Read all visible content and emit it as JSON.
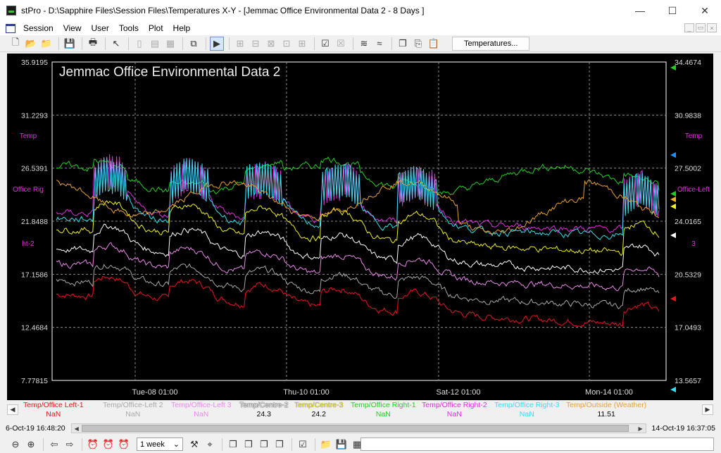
{
  "window": {
    "title": "stPro - D:\\Sapphire Files\\Session Files\\Temperatures X-Y - [Jemmac Office Environmental Data 2 - 8 Days ]",
    "minimize_glyph": "—",
    "maximize_glyph": "☐",
    "close_glyph": "✕"
  },
  "menu": {
    "items": [
      {
        "name": "menu-session",
        "label": "Session"
      },
      {
        "name": "menu-view",
        "label": "View"
      },
      {
        "name": "menu-user",
        "label": "User"
      },
      {
        "name": "menu-tools",
        "label": "Tools"
      },
      {
        "name": "menu-plot",
        "label": "Plot"
      },
      {
        "name": "menu-help",
        "label": "Help"
      }
    ],
    "mdi": [
      "_",
      "▭",
      "×"
    ]
  },
  "toolbar": {
    "buttons": [
      {
        "icon": "new-file-icon",
        "glyph": "🗋",
        "dim": false
      },
      {
        "icon": "open-folder-icon",
        "glyph": "📂",
        "dim": false
      },
      {
        "icon": "open-file-icon",
        "glyph": "📁",
        "dim": false
      },
      {
        "sep": true
      },
      {
        "icon": "save-icon",
        "glyph": "💾",
        "dim": false
      },
      {
        "sep": true
      },
      {
        "icon": "print-icon",
        "glyph": "🖶",
        "dim": false
      },
      {
        "sep": true
      },
      {
        "icon": "help-pointer-icon",
        "glyph": "↖",
        "dim": false
      },
      {
        "sep": true
      },
      {
        "icon": "layout-single-icon",
        "glyph": "▯",
        "dim": true
      },
      {
        "icon": "layout-split-icon",
        "glyph": "▤",
        "dim": true
      },
      {
        "icon": "layout-grid-icon",
        "glyph": "▦",
        "dim": true
      },
      {
        "sep": true
      },
      {
        "icon": "new-window-icon",
        "glyph": "⧉",
        "dim": false
      },
      {
        "sep": true
      },
      {
        "icon": "run-icon",
        "glyph": "▶",
        "dim": false,
        "pressed": true
      },
      {
        "sep": true
      },
      {
        "icon": "zoom-a-icon",
        "glyph": "⊞",
        "dim": true
      },
      {
        "icon": "zoom-b-icon",
        "glyph": "⊟",
        "dim": true
      },
      {
        "icon": "zoom-c-icon",
        "glyph": "⊠",
        "dim": true
      },
      {
        "icon": "zoom-d-icon",
        "glyph": "⊡",
        "dim": true
      },
      {
        "icon": "zoom-e-icon",
        "glyph": "⊞",
        "dim": true
      },
      {
        "sep": true
      },
      {
        "icon": "check-icon",
        "glyph": "☑",
        "dim": false
      },
      {
        "icon": "check-multi-icon",
        "glyph": "☒",
        "dim": true
      },
      {
        "sep": true
      },
      {
        "icon": "curve-icon",
        "glyph": "≋",
        "dim": false
      },
      {
        "icon": "wave-icon",
        "glyph": "≈",
        "dim": false
      },
      {
        "sep": true
      },
      {
        "icon": "copy-icon",
        "glyph": "❐",
        "dim": false
      },
      {
        "icon": "export-icon",
        "glyph": "⎘",
        "dim": false
      },
      {
        "icon": "paste-icon",
        "glyph": "📋",
        "dim": false
      }
    ],
    "temperatures_button": "Temperatures..."
  },
  "chart_data": {
    "type": "line",
    "title": "Jemmac Office Environmental Data 2",
    "x_ticks": [
      "Tue-08 01:00",
      "Thu-10 01:00",
      "Sat-12 01:00",
      "Mon-14 01:00"
    ],
    "y_left_ticks": [
      "35.9195",
      "31.2293",
      "26.5391",
      "21.8488",
      "17.1586",
      "12.4684",
      "7.77815"
    ],
    "y_right_ticks": [
      "34.4674",
      "30.9838",
      "27.5002",
      "24.0165",
      "20.5329",
      "17.0493",
      "13.5657"
    ],
    "y_left_label": [
      "Temp",
      "Office Rig",
      "ht-2"
    ],
    "y_right_label": [
      "Temp",
      "Office-Left",
      "3"
    ],
    "grid": true,
    "ylim_left": [
      7.77815,
      35.9195
    ],
    "series": [
      {
        "name": "Temp/Office Left-1",
        "color": "#e8141e",
        "base": 15.4,
        "amp": 1.8,
        "trend": -0.35
      },
      {
        "name": "Temp/Office-Left 2",
        "color": "#a8a8a8",
        "base": 16.6,
        "amp": 1.7,
        "trend": -0.3
      },
      {
        "name": "Temp/Office-Left 3",
        "color": "#e888e8",
        "base": 18.1,
        "amp": 1.8,
        "trend": -0.28
      },
      {
        "name": "Temp/Centre-2",
        "color": "#ffffff",
        "base": 19.4,
        "amp": 2.2,
        "trend": -0.25
      },
      {
        "name": "Temp/Centre-3",
        "color": "#f0f020",
        "base": 21.2,
        "amp": 2.6,
        "trend": -0.28
      },
      {
        "name": "Temp/Office Right-1",
        "color": "#20d020",
        "base": 24.0,
        "amp": 2.2,
        "trend": 0.05
      },
      {
        "name": "Temp/Office Right-2",
        "color": "#e030e0",
        "base": 22.6,
        "amp": 2.8,
        "trend": -0.2
      },
      {
        "name": "Temp/Office Right-3",
        "color": "#30e0f0",
        "base": 22.1,
        "amp": 3.3,
        "trend": -0.2
      },
      {
        "name": "Temp/Outside (Weather)",
        "color": "#e8a030",
        "base": 23.8,
        "amp": 1.2,
        "trend": 0.0
      }
    ]
  },
  "legend": {
    "items": [
      {
        "label": "Temp/Office Left-1",
        "value": "NaN",
        "color": "#e8141e",
        "x": 5
      },
      {
        "label": "Temp/Office-Left 2",
        "value": "NaN",
        "color": "#a8a8a8",
        "x": 118
      },
      {
        "label": "Temp/Office-Left 3",
        "value": "NaN",
        "color": "#e888e8",
        "x": 215
      },
      {
        "label": "Temp/Centre-2",
        "value": "24.3",
        "color": "#ffffff",
        "x": 312
      },
      {
        "label": "Temp/Centre-3",
        "value": "24.2",
        "color": "#f0f020",
        "x": 390
      },
      {
        "label": "Temp/Office Right-1",
        "value": "NaN",
        "color": "#20d020",
        "x": 470
      },
      {
        "label": "Temp/Office Right-2",
        "value": "NaN",
        "color": "#e030e0",
        "x": 571
      },
      {
        "label": "Temp/Office Right-3",
        "value": "NaN",
        "color": "#30e0f0",
        "x": 674
      },
      {
        "label": "Temp/Outside (Weather)",
        "value": "11.51",
        "color": "#e8a030",
        "x": 776
      }
    ]
  },
  "timebar": {
    "start": "6-Oct-19 16:48:20",
    "end": "14-Oct-19 16:37:05",
    "thumb_start_fraction": 0.0,
    "thumb_end_fraction": 0.988
  },
  "bottom_toolbar": {
    "buttons_left": [
      {
        "icon": "zoom-out-icon",
        "glyph": "⊖"
      },
      {
        "icon": "zoom-in-icon",
        "glyph": "⊕"
      },
      {
        "sep": true
      },
      {
        "icon": "back-icon",
        "glyph": "⇦"
      },
      {
        "icon": "forward-icon",
        "glyph": "⇨"
      },
      {
        "sep": true
      },
      {
        "icon": "alarm-a-icon",
        "glyph": "⏰"
      },
      {
        "icon": "alarm-b-icon",
        "glyph": "⏰"
      },
      {
        "icon": "alarm-c-icon",
        "glyph": "⏰"
      }
    ],
    "period": "1 week",
    "buttons_right": [
      {
        "icon": "tools-icon",
        "glyph": "⚒"
      },
      {
        "icon": "pin-icon",
        "glyph": "⌖"
      },
      {
        "sep": true
      },
      {
        "icon": "window-a-icon",
        "glyph": "❐"
      },
      {
        "icon": "window-b-icon",
        "glyph": "❐"
      },
      {
        "icon": "window-c-icon",
        "glyph": "❐"
      },
      {
        "icon": "window-d-icon",
        "glyph": "❐"
      },
      {
        "sep": true
      },
      {
        "icon": "check-edit-icon",
        "glyph": "☑"
      },
      {
        "sep": true
      },
      {
        "icon": "folder-icon",
        "glyph": "📁"
      },
      {
        "icon": "disk-icon",
        "glyph": "💾"
      },
      {
        "icon": "grid-icon",
        "glyph": "▦"
      },
      {
        "sep": true
      },
      {
        "icon": "checkmark-icon",
        "glyph": "✔"
      }
    ]
  }
}
